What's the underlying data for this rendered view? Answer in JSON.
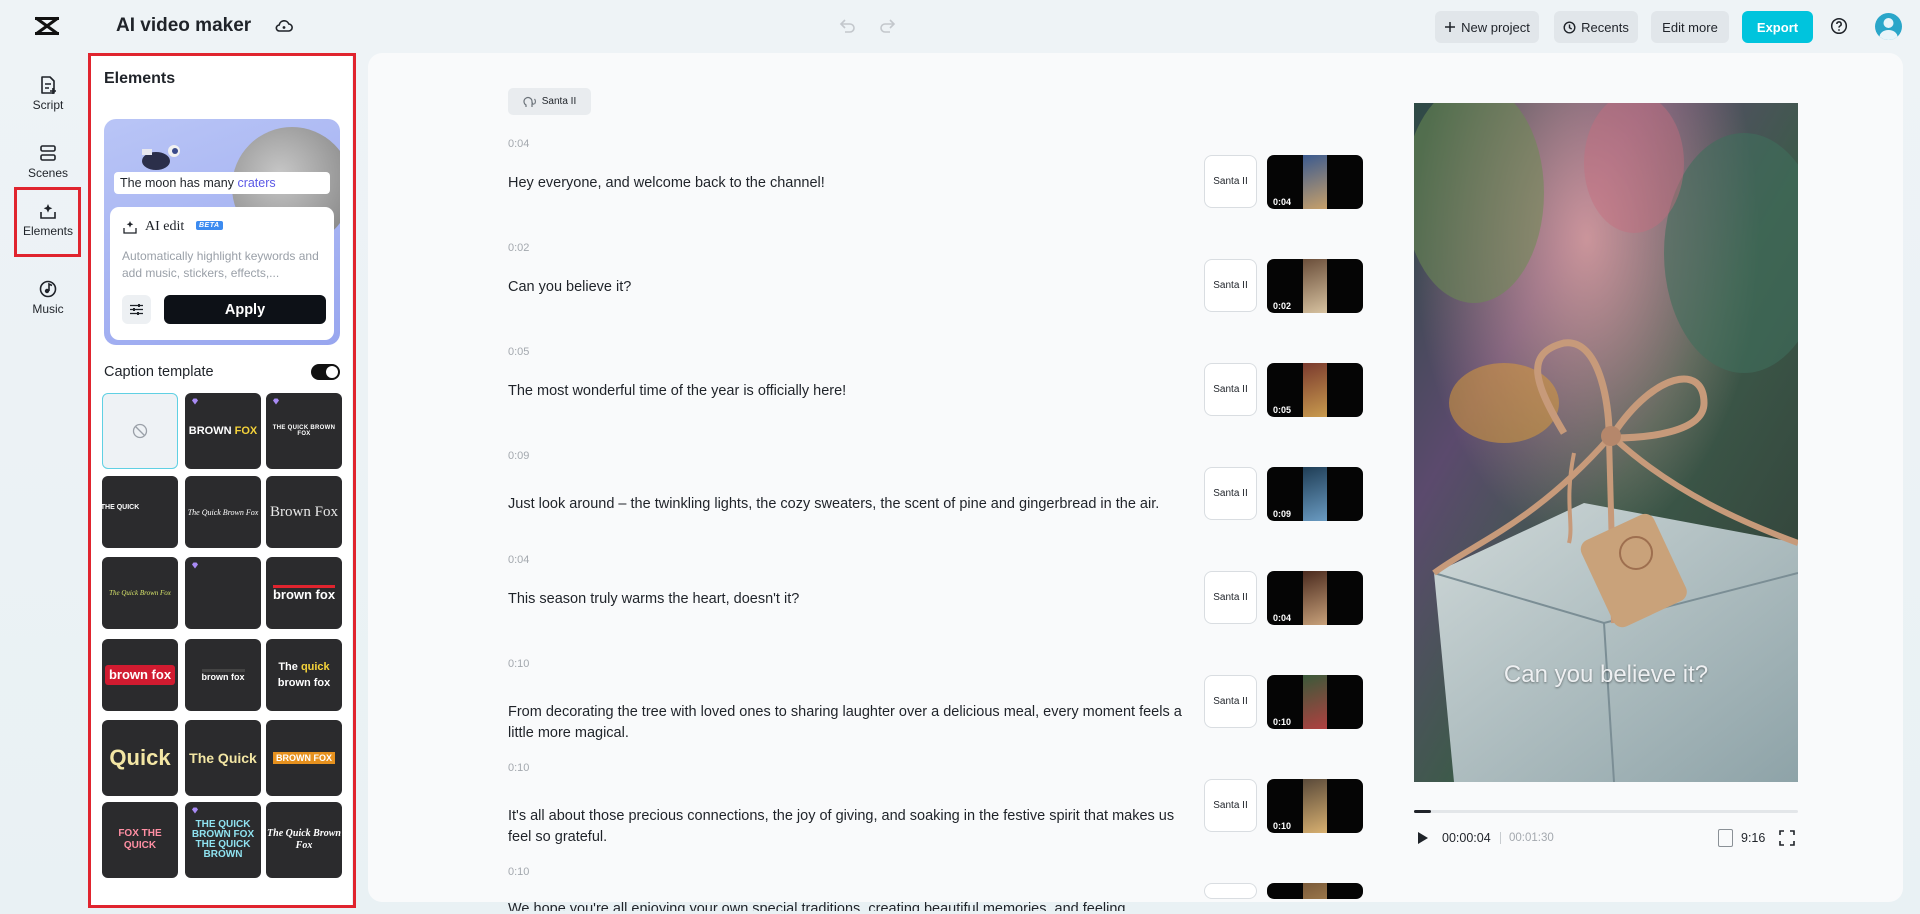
{
  "app": {
    "title": "AI video maker"
  },
  "toolbar": {
    "new_project": "New project",
    "recents": "Recents",
    "edit_more": "Edit more",
    "export": "Export"
  },
  "nav": {
    "items": [
      {
        "label": "Script",
        "icon": "script-icon"
      },
      {
        "label": "Scenes",
        "icon": "scenes-icon"
      },
      {
        "label": "Elements",
        "icon": "elements-icon",
        "active": true
      },
      {
        "label": "Music",
        "icon": "music-icon"
      }
    ]
  },
  "panel": {
    "title": "Elements",
    "ai_card": {
      "preview_text": "The moon has many",
      "preview_keyword": "craters",
      "title": "AI edit",
      "badge": "BETA",
      "description": "Automatically highlight keywords and add music, stickers, effects,...",
      "apply": "Apply"
    },
    "caption_template": {
      "label": "Caption template",
      "enabled": true
    },
    "templates": [
      {
        "text": "",
        "kind": "none"
      },
      {
        "text": "BROWN FOX",
        "premium": true
      },
      {
        "text": "THE QUICK BROWN FOX",
        "premium": true
      },
      {
        "text": "THE QUICK"
      },
      {
        "text": "The Quick Brown Fox"
      },
      {
        "text": "Brown Fox"
      },
      {
        "text": "The Quick Brown Fox"
      },
      {
        "text": "",
        "premium": true
      },
      {
        "text": "brown fox"
      },
      {
        "text": "brown fox"
      },
      {
        "text": "brown fox"
      },
      {
        "text": "The quick brown fox"
      },
      {
        "text": "Quick"
      },
      {
        "text": "The Quick"
      },
      {
        "text": "BROWN FOX"
      },
      {
        "text": "FOX THE QUICK"
      },
      {
        "text": "THE QUICK BROWN FOX THE QUICK BROWN",
        "premium": true
      },
      {
        "text": "The Quick Brown Fox"
      }
    ]
  },
  "script": {
    "speaker": "Santa II",
    "scenes": [
      {
        "time": "0:04",
        "text": "Hey everyone, and welcome back to the channel!",
        "voice": "Santa II",
        "duration": "0:04"
      },
      {
        "time": "0:02",
        "text": "Can you believe it?",
        "voice": "Santa II",
        "duration": "0:02"
      },
      {
        "time": "0:05",
        "text": "The most wonderful time of the year is officially here!",
        "voice": "Santa II",
        "duration": "0:05"
      },
      {
        "time": "0:09",
        "text": "Just look around – the twinkling lights, the cozy sweaters, the scent of pine and gingerbread in the air.",
        "voice": "Santa II",
        "duration": "0:09"
      },
      {
        "time": "0:04",
        "text": "This season truly warms the heart, doesn't it?",
        "voice": "Santa II",
        "duration": "0:04"
      },
      {
        "time": "0:10",
        "text": "From decorating the tree with loved ones to sharing laughter over a delicious meal, every moment feels a little more magical.",
        "voice": "Santa II",
        "duration": "0:10"
      },
      {
        "time": "0:10",
        "text": "It's all about those precious connections, the joy of giving, and soaking in the festive spirit that makes us feel so grateful.",
        "voice": "Santa II",
        "duration": "0:10"
      },
      {
        "time": "0:10",
        "text": "We hope you're all enjoying your own special traditions, creating beautiful memories, and feeling",
        "voice": "",
        "duration": ""
      }
    ]
  },
  "preview": {
    "caption": "Can you believe it?",
    "current_time": "00:00:04",
    "total_time": "00:01:30",
    "progress": 0.044,
    "aspect_ratio": "9:16"
  },
  "colors": {
    "accent": "#00c4dd",
    "highlight_box": "#e0242e",
    "keyword": "#5b58e6"
  }
}
